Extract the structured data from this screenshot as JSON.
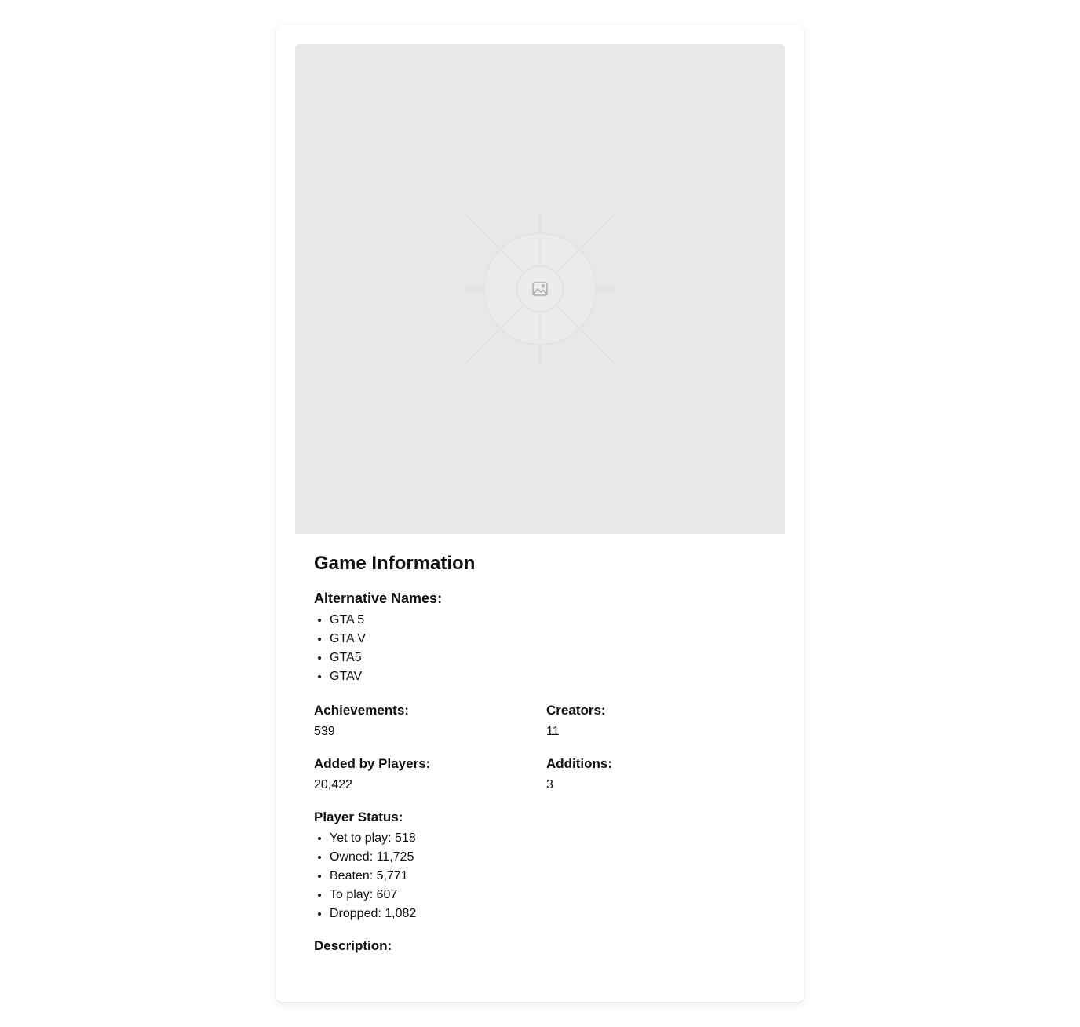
{
  "game_info": {
    "heading": "Game Information",
    "alt_names_label": "Alternative Names:",
    "alt_names": [
      "GTA 5",
      "GTA V",
      "GTA5",
      "GTAV"
    ],
    "achievements_label": "Achievements:",
    "achievements_value": "539",
    "creators_label": "Creators:",
    "creators_value": "11",
    "added_label": "Added by Players:",
    "added_value": "20,422",
    "additions_label": "Additions:",
    "additions_value": "3",
    "status_label": "Player Status:",
    "status_items": [
      "Yet to play: 518",
      "Owned: 11,725",
      "Beaten: 5,771",
      "To play: 607",
      "Dropped: 1,082"
    ],
    "description_label": "Description:"
  },
  "icons": {
    "image_placeholder": "image-icon"
  },
  "colors": {
    "placeholder_bg": "#e8e8e8",
    "text": "#111111"
  }
}
